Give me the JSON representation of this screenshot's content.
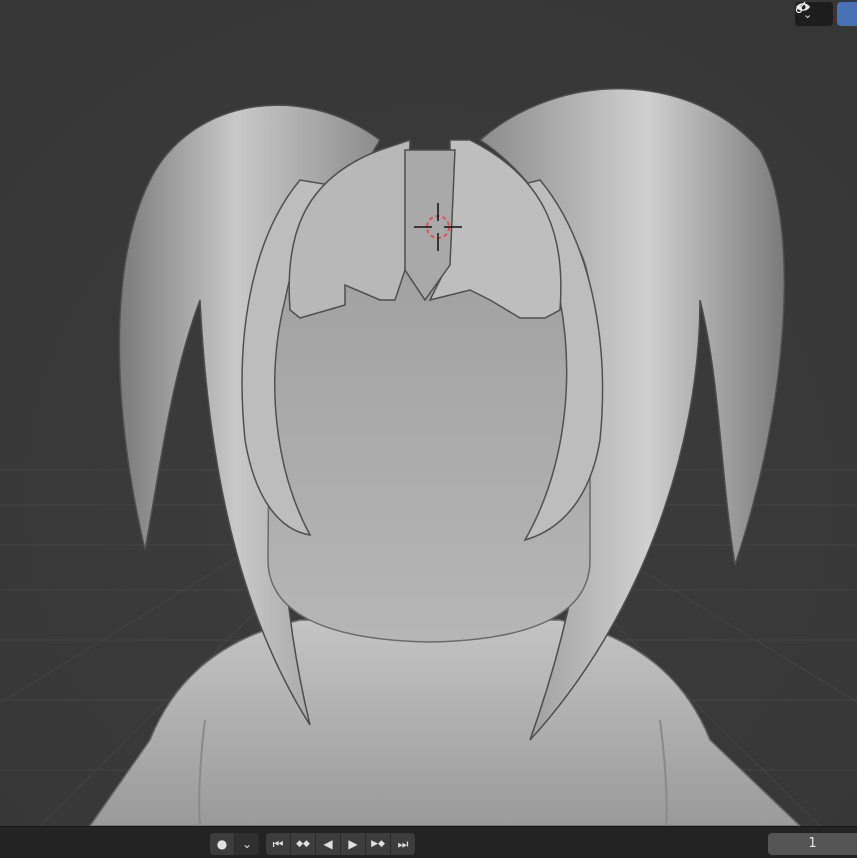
{
  "viewport": {
    "background": "#3a3a3a",
    "model_color": "#b3b3b3",
    "cursor_icon": "3d-cursor-icon"
  },
  "overlay_buttons": [
    {
      "name": "visibility-dropdown",
      "icon": "eye-icon",
      "chevron": "⌄"
    },
    {
      "name": "overlay-toggle",
      "icon": "overlay-icon"
    }
  ],
  "timeline": {
    "record_icon": "●",
    "keying_chevron": "⌄",
    "playback": {
      "jump_start": "⏮",
      "prev_keyframe": "◆◆",
      "play_reverse": "◀",
      "play": "▶",
      "next_keyframe": "▶◆",
      "jump_end": "⏭"
    },
    "current_frame": "1"
  }
}
